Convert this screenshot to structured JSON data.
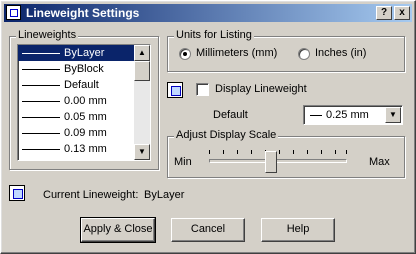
{
  "window": {
    "title": "Lineweight Settings",
    "help_btn": "?",
    "close_btn": "x"
  },
  "lineweights": {
    "label": "Lineweights",
    "items": [
      "ByLayer",
      "ByBlock",
      "Default",
      "0.00 mm",
      "0.05 mm",
      "0.09 mm",
      "0.13 mm"
    ],
    "selected": "ByLayer"
  },
  "units": {
    "label": "Units for Listing",
    "mm_label": "Millimeters (mm)",
    "in_label": "Inches (in)",
    "selected": "mm"
  },
  "display": {
    "label": "Display Lineweight",
    "checked": false
  },
  "default": {
    "label": "Default",
    "value": "0.25 mm"
  },
  "scale": {
    "label": "Adjust Display Scale",
    "min_label": "Min",
    "max_label": "Max",
    "value_fraction": 0.44
  },
  "current": {
    "label": "Current Lineweight:",
    "value": "ByLayer"
  },
  "buttons": {
    "apply": "Apply & Close",
    "cancel": "Cancel",
    "help": "Help"
  }
}
